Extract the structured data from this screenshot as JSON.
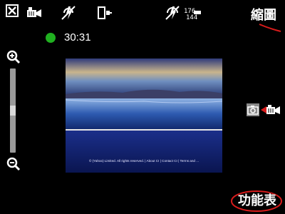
{
  "status": {
    "timer": "30:31",
    "recording_color": "#20b020",
    "signal_top": "176",
    "signal_bottom": "144"
  },
  "softkeys": {
    "top_right": "縮圖",
    "bottom_right": "功能表"
  },
  "zoom": {
    "in_icon": "zoom-in-icon",
    "out_icon": "zoom-out-icon",
    "level": 0.5
  },
  "preview": {
    "caption": "© (Yahoo) Limited. All rights reserved. | About CI | Contact CI | Terms and ..."
  },
  "mode_switch": {
    "camera_icon": "camera-icon",
    "video_icon": "video-camera-icon"
  },
  "colors": {
    "accent_red": "#d81b1b"
  }
}
